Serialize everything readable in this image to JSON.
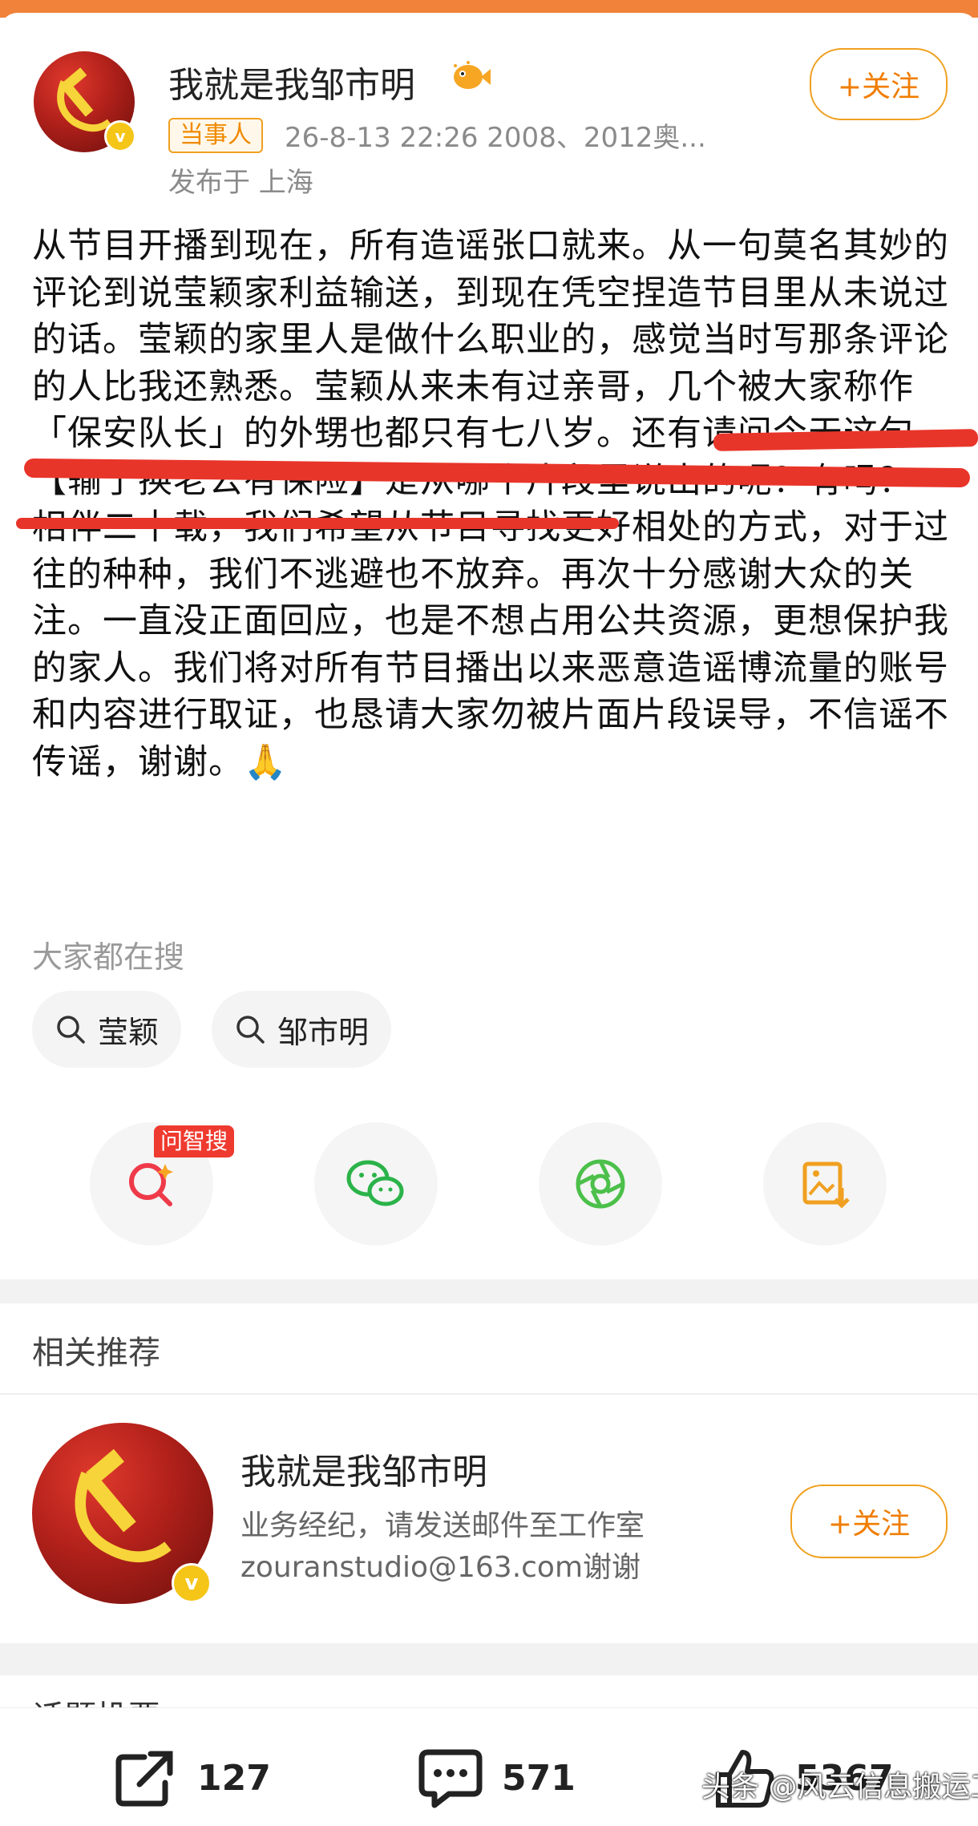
{
  "post": {
    "author": "我就是我邹市明",
    "follow_label": "+关注",
    "tag": "当事人",
    "meta": "26-8-13 22:26  2008、2012奥...",
    "location": "发布于 上海",
    "paragraphs": [
      "从节目开播到现在，所有造谣张口就来。从一句莫名其妙的评论到说莹颖家利益输送，到现在凭空捏造节目里从未说过的话。莹颖的家里人是做什么职业的，感觉当时写那条评论的人比我还熟悉。莹颖从来未有过亲哥，几个被大家称作「保安队长」的外甥也都只有七八岁。还有请问今天这句【输了换老公有保险】是从哪个片段里说出的呢？有吗？",
      "相伴二十载，我们希望从节目寻找更好相处的方式，对于过往的种种，我们不逃避也不放弃。再次十分感谢大众的关注。一直没正面回应，也是不想占用公共资源，更想保护我的家人。我们将对所有节目播出以来恶意造谣博流量的账号和内容进行取证，也恳请大家勿被片面片段误导，不信谣不传谣，谢谢。🙏"
    ]
  },
  "search": {
    "heading": "大家都在搜",
    "chips": [
      "莹颖",
      "邹市明"
    ]
  },
  "actions": {
    "ai_badge": "问智搜",
    "icons": [
      "ai-search-icon",
      "wechat-icon",
      "moments-icon",
      "save-image-icon"
    ]
  },
  "recommend": {
    "title": "相关推荐",
    "name": "我就是我邹市明",
    "desc_line1": "业务经纪，请发送邮件至工作室",
    "desc_line2": "zouranstudio@163.com谢谢",
    "follow_label": "+关注"
  },
  "topic_partial": "话题投票",
  "bottom": {
    "share_count": "127",
    "comment_count": "571",
    "like_count": "5367"
  },
  "watermark": "头条 @风云信息搬运工",
  "colors": {
    "accent": "#f07d00",
    "highlight": "#e8352a",
    "topbar": "#f0823a"
  }
}
